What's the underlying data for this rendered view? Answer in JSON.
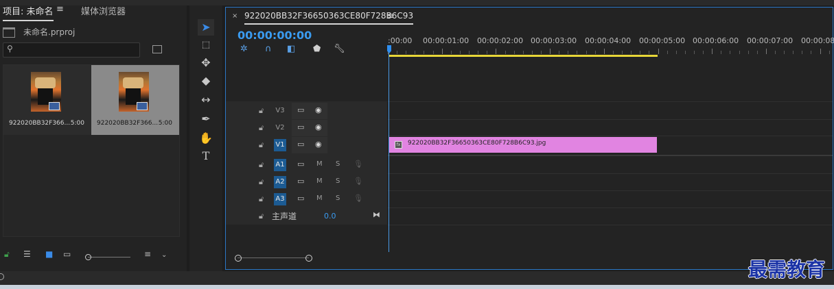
{
  "project_panel": {
    "tab_project": "项目: 未命名",
    "tab_menu": "≡",
    "tab_media_browser": "媒体浏览器",
    "project_file": "未命名.prproj",
    "search_placeholder": "",
    "items": [
      {
        "name": "922020BB32F366...",
        "duration": "5:00",
        "selected": false
      },
      {
        "name": "922020BB32F366...",
        "duration": "5:00",
        "selected": true
      }
    ]
  },
  "tools": [
    "selection-tool",
    "track-select-tool",
    "ripple-edit-tool",
    "razor-tool",
    "slip-tool",
    "pen-tool",
    "hand-tool",
    "type-tool"
  ],
  "timeline": {
    "close_label": "×",
    "sequence_name": "922020BB32F36650363CE80F728B6C93",
    "menu": "≡",
    "timecode": "00:00:00:00",
    "ruler_labels": [
      ":00:00",
      "00:00:01:00",
      "00:00:02:00",
      "00:00:03:00",
      "00:00:04:00",
      "00:00:05:00",
      "00:00:06:00",
      "00:00:07:00",
      "00:00:08:0"
    ],
    "video_tracks": [
      {
        "label": "V3",
        "targeted": false
      },
      {
        "label": "V2",
        "targeted": false
      },
      {
        "label": "V1",
        "targeted": true
      }
    ],
    "audio_tracks": [
      {
        "label": "A1",
        "mute": "M",
        "solo": "S"
      },
      {
        "label": "A2",
        "mute": "M",
        "solo": "S"
      },
      {
        "label": "A3",
        "mute": "M",
        "solo": "S"
      }
    ],
    "master": {
      "label": "主声道",
      "value": "0.0"
    },
    "clip": {
      "name": "922020BB32F36650363CE80F728B6C93.jpg",
      "icon": "fx",
      "color": "#e184e1"
    }
  },
  "watermark": "最需教育"
}
